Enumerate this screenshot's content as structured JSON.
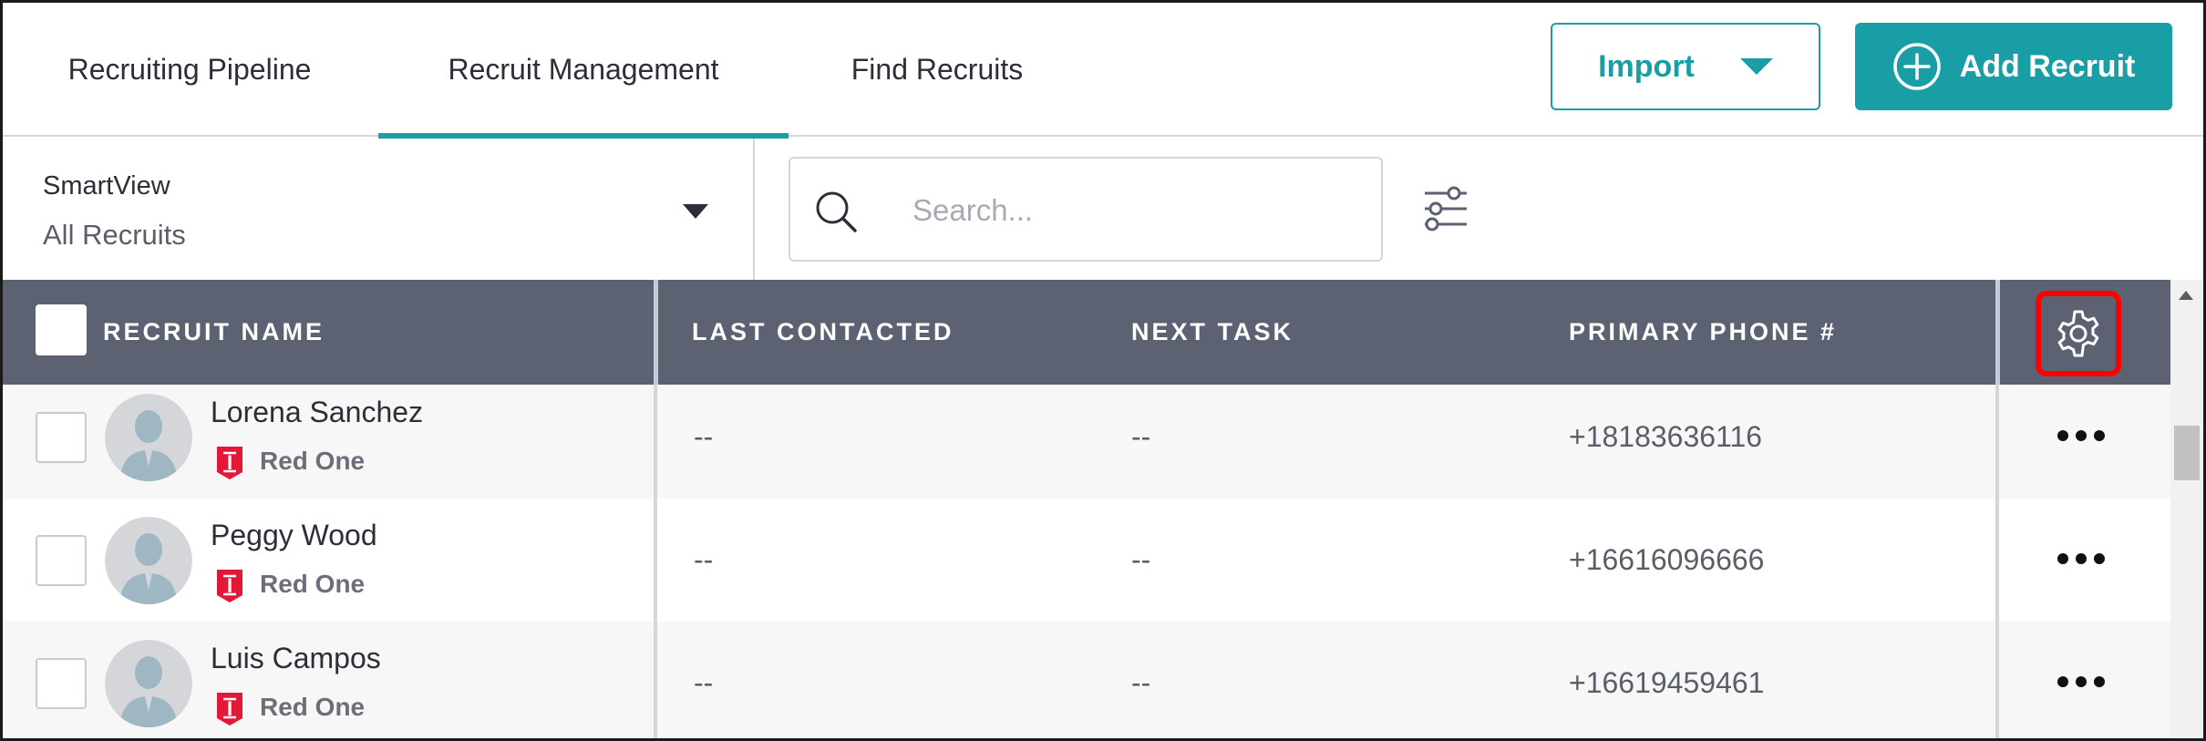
{
  "tabs": [
    {
      "label": "Recruiting Pipeline",
      "active": false
    },
    {
      "label": "Recruit Management",
      "active": true
    },
    {
      "label": "Find Recruits",
      "active": false
    }
  ],
  "actions": {
    "import_label": "Import",
    "add_label": "Add Recruit"
  },
  "smartview": {
    "label": "SmartView",
    "value": "All Recruits"
  },
  "search": {
    "placeholder": "Search..."
  },
  "table": {
    "columns": [
      "RECRUIT NAME",
      "LAST CONTACTED",
      "NEXT TASK",
      "PRIMARY PHONE #"
    ],
    "rows": [
      {
        "name": "Lorena Sanchez",
        "team": "Red One",
        "last_contacted": "--",
        "next_task": "--",
        "phone": "+18183636116"
      },
      {
        "name": "Peggy Wood",
        "team": "Red One",
        "last_contacted": "--",
        "next_task": "--",
        "phone": "+16616096666"
      },
      {
        "name": "Luis Campos",
        "team": "Red One",
        "last_contacted": "--",
        "next_task": "--",
        "phone": "+16619459461"
      }
    ]
  },
  "icons": {
    "add": "plus-circle-icon",
    "import_caret": "chevron-down-icon",
    "search": "search-icon",
    "filter": "sliders-icon",
    "settings": "gear-icon",
    "row_menu": "more-horizontal-icon",
    "team_badge": "team-badge-icon",
    "avatar": "avatar-placeholder-icon"
  },
  "colors": {
    "accent": "#1a9ea6",
    "header_bg": "#5c6272",
    "highlight": "#ff0000",
    "badge": "#e31837"
  }
}
